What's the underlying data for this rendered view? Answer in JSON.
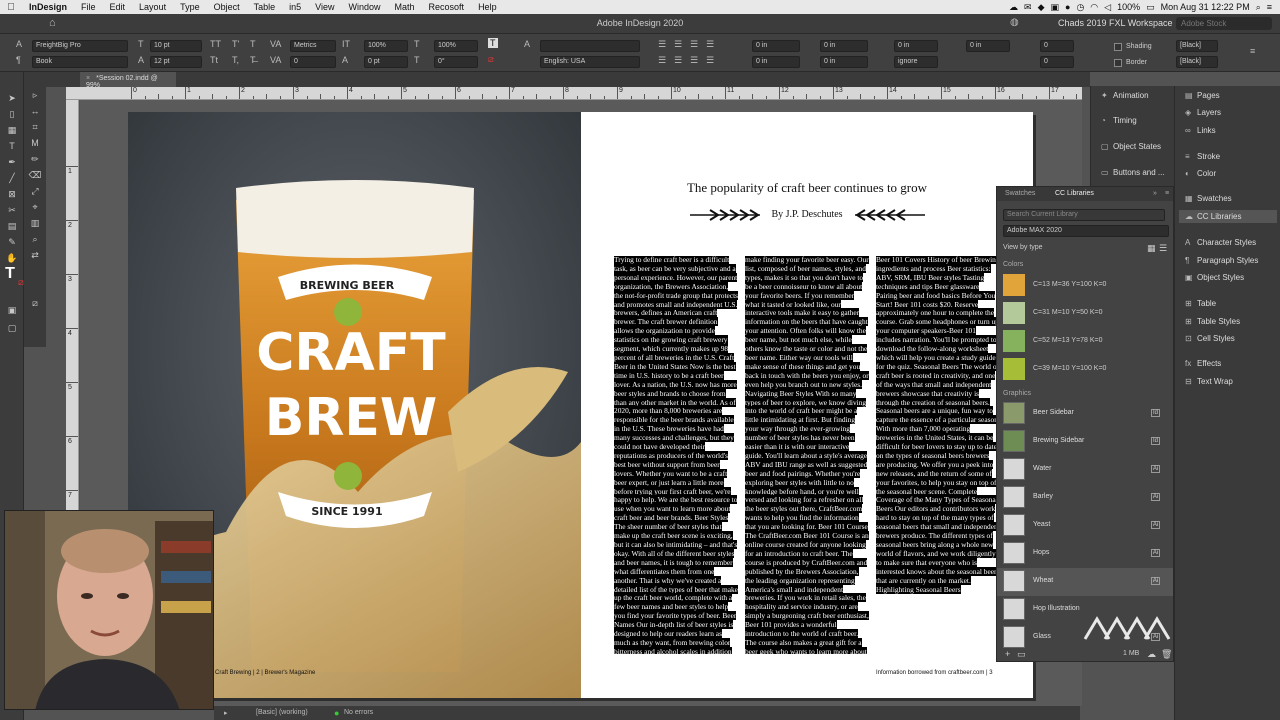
{
  "menubar": {
    "app": "InDesign",
    "items": [
      "File",
      "Edit",
      "Layout",
      "Type",
      "Object",
      "Table",
      "in5",
      "View",
      "Window",
      "Math",
      "Recosoft",
      "Help"
    ],
    "battery": "100%",
    "clock": "Mon Aug 31  12:22 PM"
  },
  "titlebar": {
    "title": "Adobe InDesign 2020",
    "workspace": "Chads 2019 FXL Workspace",
    "search_placeholder": "Adobe Stock"
  },
  "control": {
    "font_family": "FreightBig Pro",
    "font_style": "Book",
    "font_size": "10 pt",
    "leading": "12 pt",
    "kerning": "Metrics",
    "tracking": "0",
    "vscale": "100%",
    "hscale": "100%",
    "baseline": "0 pt",
    "skew": "0°",
    "language": "English: USA",
    "indent_left": "0 in",
    "indent_right": "0 in",
    "indent_first": "0 in",
    "indent_last": "0 in",
    "space_before": "0 in",
    "space_after": "0 in",
    "drop_lines": "0",
    "drop_chars": "0",
    "hyphen": "ignore",
    "shading_label": "Shading",
    "border_label": "Border",
    "swatch_shading": "[Black]",
    "swatch_border": "[Black]"
  },
  "document": {
    "tab": "*Session 02.indd @ 99%"
  },
  "ruler_h": [
    "0",
    "1",
    "2",
    "3",
    "4",
    "5",
    "6",
    "7",
    "8",
    "9",
    "10",
    "11",
    "12",
    "13",
    "14",
    "15",
    "16",
    "17"
  ],
  "ruler_v": [
    "1",
    "2",
    "3",
    "4",
    "5",
    "6",
    "7",
    "8",
    "9"
  ],
  "cover": {
    "banner_top": "BREWING BEER",
    "line1": "CRAFT",
    "line2": "BREW",
    "banner_bottom": "SINCE 1991",
    "footer": "Craft Brewing | 2 | Brewer's Magazine"
  },
  "article": {
    "title": "The popularity of craft beer continues to grow",
    "byline": "By J.P. Deschutes",
    "col1": "Trying to define craft beer is a difficult task, as beer can be very subjective and a personal experience. However, our parent organization, the Brewers Association, the not-for-profit trade group that protects and promotes small and independent U.S. brewers, defines an American craft brewer. The craft brewer definition allows the organization to provide statistics on the growing craft brewery segment, which currently makes up 98 percent of all breweries in the U.S. Craft Beer in the United States Now is the best time in U.S. history to be a craft beer lover. As a nation, the U.S. now has more beer styles and brands to choose from than any other market in the world. As of 2020, more than 8,000 breweries are responsible for the beer brands available in the U.S. These breweries have had many successes and challenges, but they could not have developed their reputations as producers of the world's best beer without support from beer lovers. Whether you want to be a craft beer expert, or just learn a little more before trying your first craft beer, we're happy to help. We are the best resource to use when you want to learn more about craft beer and beer brands. Beer Styles The sheer number of beer styles that make up the craft beer scene is exciting, but it can also be intimidating – and that's okay. With all of the different beer styles and beer names, it is tough to remember what differentiates them from one another. That is why we've created a detailed list of the types of beer that make up the craft beer world, complete with a few beer names and beer styles to help you find your favorite types of beer. Beer Names Our in-depth list of beer styles is designed to help our readers learn as much as they want, from brewing color bitterness and alcohol scales in addition to our taste categories",
    "col2": "make finding your favorite beer easy. Our list, composed of beer names, styles, and types, makes it so that you don't have to be a beer connoisseur to know all about your favorite beers. If you remember what it tasted or looked like, our interactive tools make it easy to gather information on the beers that have caught your attention. Often folks will know the beer name, but not much else, while others know the taste or color and not the beer name. Either way our tools will make sense of these things and get you back in touch with the beers you enjoy, or even help you branch out to new styles. Navigating Beer Styles With so many types of beer to explore, we know diving into the world of craft beer might be a little intimidating at first. But finding your way through the ever-growing number of beer styles has never been easier than it is with our interactive guide. You'll learn about a style's average ABV and IBU range as well as suggested beer and food pairings. Whether you're exploring beer styles with little to no knowledge before hand, or you're well versed and looking for a refresher on all the beer styles out there, CraftBeer.com wants to help you find the information that you are looking for. Beer 101 Course The CraftBeer.com Beer 101 Course is an online course created for anyone looking for an introduction to craft beer. The course is produced by CraftBeer.com and published by the Brewers Association, the leading organization representing America's small and independent breweries. If you work in retail sales, the hospitality and service industry, or are simply a burgeoning craft beer enthusiast, Beer 101 provides a wonderful introduction to the world of craft beer. The course also makes a great gift for a beer geek who wants to learn more about beer!",
    "col3": "Beer 101 Covers History of beer Brewing ingredients and process Beer statistics: ABV, SRM, IBU Beer styles Tasting techniques and tips Beer glassware Pairing beer and food basics Before You Start! Beer 101 costs $20. Reserve approximately one hour to complete the course. Grab some headphones or turn up your computer speakers-Beer 101 includes narration. You'll be prompted to download the follow-along worksheet which will help you create a study guide for the quiz. Seasonal Beers The world of craft beer is rooted in creativity, and one of the ways that small and independent brewers showcase that creativity is through the creation of seasonal beers. Seasonal beers are a unique, fun way to capture the essence of a particular season. With more than 7,000 operating breweries in the United States, it can be difficult for beer lovers to stay up to date on the types of seasonal beers brewers are producing. We offer you a peek into new releases, and the return of some of your favorites, to help you stay on top of the seasonal beer scene. Complete Coverage of the Many Types of Seasonal Beers Our editors and contributors work hard to stay on top of the many types of seasonal beers that small and independent brewers produce. The different types of seasonal beers bring along a whole new world of flavors, and we work diligently to make sure that everyone who is interested knows about the seasonal beers that are currently on the market. Highlighting Seasonal Beers",
    "footer": "Information borrowed from craftbeer.com | 3"
  },
  "status": {
    "style": "[Basic] (working)",
    "errors": "No errors"
  },
  "cc_panel": {
    "tab_swatches": "Swatches",
    "tab_cc": "CC Libraries",
    "search_placeholder": "Search Current Library",
    "library": "Adobe MAX 2020",
    "view_by": "View by type",
    "colors_header": "Colors",
    "colors": [
      {
        "label": "C=13 M=36 Y=100 K=0",
        "hex": "#e0a43a"
      },
      {
        "label": "C=31 M=10 Y=50 K=0",
        "hex": "#b3c99a"
      },
      {
        "label": "C=52 M=13 Y=78 K=0",
        "hex": "#86b15d"
      },
      {
        "label": "C=39 M=10 Y=100 K=0",
        "hex": "#a6be37"
      }
    ],
    "graphics_header": "Graphics",
    "graphics": [
      "Beer Sidebar",
      "Brewing Sidebar",
      "Water",
      "Barley",
      "Yeast",
      "Hops",
      "Wheat",
      "Hop Illustration",
      "Glass"
    ],
    "size": "1 MB"
  },
  "dock_left": [
    "Animation",
    "Timing",
    "Object States",
    "Buttons and ..."
  ],
  "dock_right": [
    "Pages",
    "Layers",
    "Links",
    "Stroke",
    "Color",
    "Swatches",
    "CC Libraries",
    "Character Styles",
    "Paragraph Styles",
    "Object Styles",
    "Table",
    "Table Styles",
    "Cell Styles",
    "Effects",
    "Text Wrap"
  ]
}
